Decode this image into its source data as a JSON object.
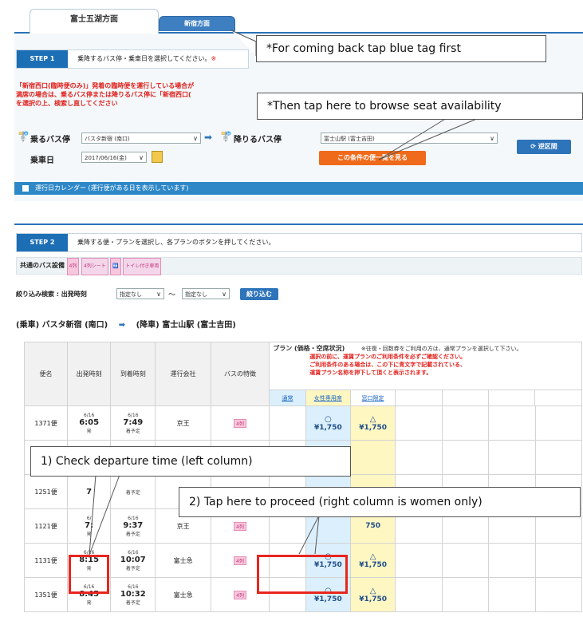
{
  "tabs": {
    "active": "富士五湖方面",
    "blue": "新宿方面"
  },
  "step1": {
    "badge": "STEP 1",
    "text": "乗降するバス停・乗車日を選択してください。",
    "mark": "※",
    "notice_line1": "「新宿西口(臨時便のみ)」発着の臨時便を運行している場合が",
    "notice_line2": "満席の場合は、乗るバス停または降りるバス停に「新宿西口(",
    "notice_line3": "を選択の上、検索し直してください",
    "board_label": "乗るバス停",
    "board_value": "バスタ新宿 (南口)",
    "alight_label": "降りるバス停",
    "alight_value": "富士山駅 (富士吉田)",
    "date_label": "乗車日",
    "date_value": "2017/06/16(金)",
    "search_button": "この条件の便一覧を見る",
    "reverse_button": "逆区間",
    "calendar_bar": "運行日カレンダー (運行便がある日を表示しています)"
  },
  "callouts": {
    "c1": "*For coming back tap blue tag first",
    "c2": "*Then tap here to browse seat availability",
    "c3": "1) Check departure time (left column)",
    "c4": "2) Tap here to proceed (right column is women only)"
  },
  "step2": {
    "badge": "STEP 2",
    "text": "乗降する便・プランを選択し、各プランのボタンを押してください。",
    "facility_label": "共通のバス設備",
    "facility_seat": "4列シート",
    "facility_toilet": "トイレ付き車両",
    "filter_label": "絞り込み検索 : 出発時刻",
    "filter_from": "指定なし",
    "filter_sep": "〜",
    "filter_to": "指定なし",
    "filter_button": "絞り込む",
    "route_from": "(乗車) バスタ新宿 (南口)",
    "route_to": "(降車) 富士山駅 (富士吉田)",
    "headers": {
      "name": "便名",
      "dep": "出発時刻",
      "arr": "到着時刻",
      "company": "運行会社",
      "features": "バスの特徴",
      "plan": "プラン (価格・空席状況)",
      "plan_note": "※往復・回数券をご利用の方は、通常プランを選択して下さい。",
      "plan_red1": "選択の前に、運賃プランのご利用条件を必ずご確認ください。",
      "plan_red2": "ご利用条件のある場合は、この下に青文字で記載されている、",
      "plan_red3": "運賃プラン名称を押下して頂くと表示されます。",
      "plan_normal": "通常",
      "plan_women": "女性専用席",
      "plan_web": "窓口限定"
    },
    "rows": [
      {
        "name": "1371便",
        "dep_date": "6/16",
        "dep_time": "6:05",
        "dep_sub": "発",
        "arr_date": "6/16",
        "arr_time": "7:49",
        "arr_sub": "着予定",
        "company": "京王",
        "feature": "4列",
        "normal_mark": "○",
        "normal_price": "¥1,750",
        "women_mark": "△",
        "women_price": "¥1,750"
      },
      {
        "name": "1",
        "dep_date": "",
        "dep_time": "",
        "dep_sub": "",
        "arr_date": "",
        "arr_time": "",
        "arr_sub": "",
        "company": "",
        "feature": "",
        "normal_mark": "",
        "normal_price": "",
        "women_mark": "",
        "women_price": ""
      },
      {
        "name": "1251便",
        "dep_date": "",
        "dep_time": "7",
        "dep_sub": "",
        "arr_date": "",
        "arr_time": "",
        "arr_sub": "着予定",
        "company": "富",
        "feature": "",
        "normal_mark": "",
        "normal_price": "",
        "women_mark": "",
        "women_price": ""
      },
      {
        "name": "1121便",
        "dep_date": "6/",
        "dep_time": "7:",
        "dep_sub": "発",
        "arr_date": "6/16",
        "arr_time": "9:37",
        "arr_sub": "着予定",
        "company": "京王",
        "feature": "4列",
        "normal_mark": "",
        "normal_price": "",
        "women_mark": "",
        "women_price": "750"
      },
      {
        "name": "1131便",
        "dep_date": "6/16",
        "dep_time": "8:15",
        "dep_sub": "発",
        "arr_date": "6/16",
        "arr_time": "10:07",
        "arr_sub": "着予定",
        "company": "富士急",
        "feature": "4列",
        "normal_mark": "○",
        "normal_price": "¥1,750",
        "women_mark": "△",
        "women_price": "¥1,750"
      },
      {
        "name": "1351便",
        "dep_date": "6/16",
        "dep_time": "8:45",
        "dep_sub": "発",
        "arr_date": "6/16",
        "arr_time": "10:32",
        "arr_sub": "着予定",
        "company": "富士急",
        "feature": "4列",
        "normal_mark": "○",
        "normal_price": "¥1,750",
        "women_mark": "△",
        "women_price": "¥1,750"
      }
    ]
  },
  "colors": {
    "brand_blue": "#1d6fb5",
    "accent_orange": "#ef6a1a",
    "highlight_red": "#e8261f"
  }
}
